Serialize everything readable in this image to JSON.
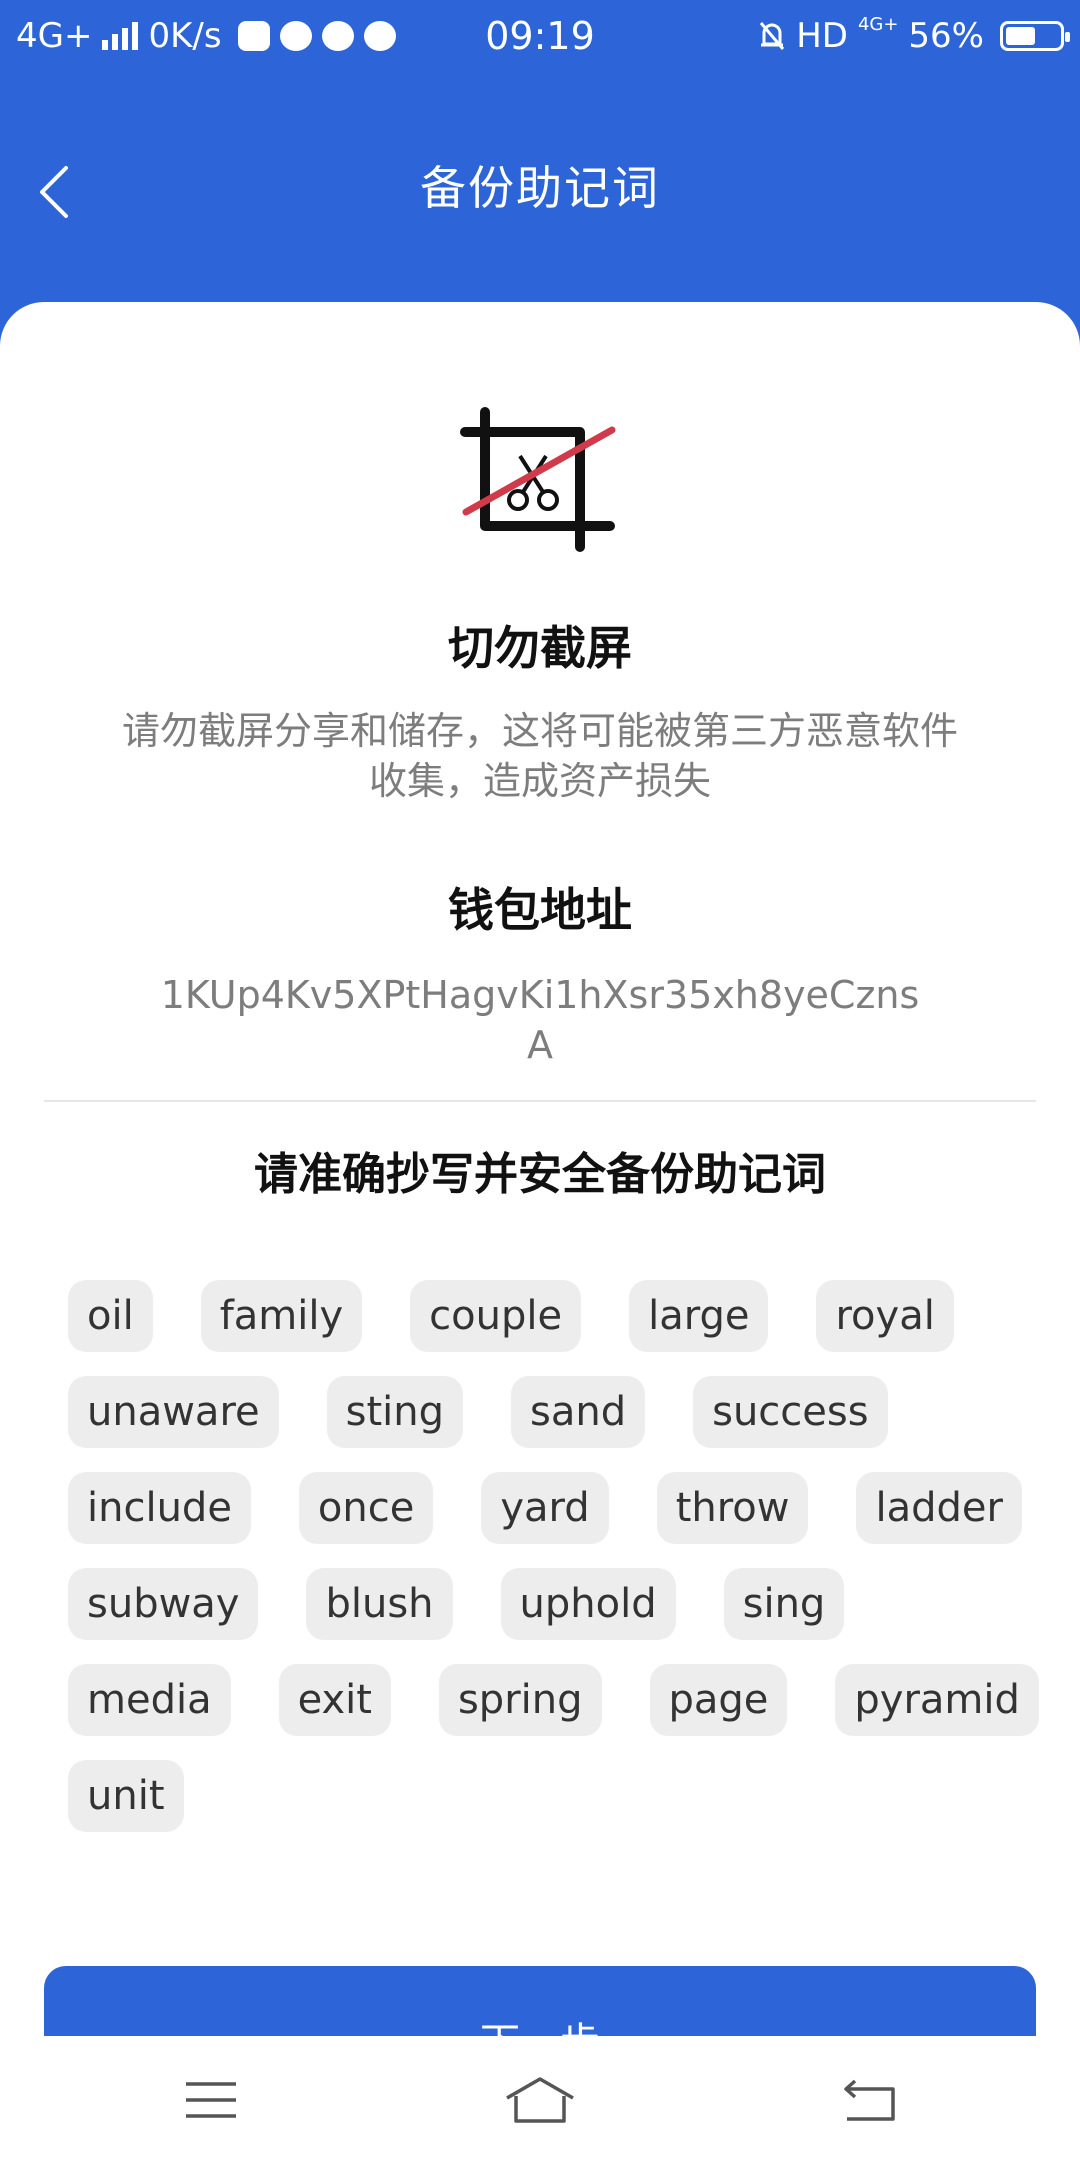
{
  "status_bar": {
    "network": "4G+",
    "speed": "0K/s",
    "time": "09:19",
    "hd": "HD",
    "network_right": "4G+",
    "battery": "56%",
    "battery_level": 0.56
  },
  "header": {
    "title": "备份助记词"
  },
  "warning": {
    "title": "切勿截屏",
    "text": "请勿截屏分享和储存，这将可能被第三方恶意软件收集，造成资产损失"
  },
  "address": {
    "title": "钱包地址",
    "value": "1KUp4Kv5XPtHagvKi1hXsr35xh8yeCznsA"
  },
  "backup": {
    "title": "请准确抄写并安全备份助记词",
    "words": [
      "oil",
      "family",
      "couple",
      "large",
      "royal",
      "unaware",
      "sting",
      "sand",
      "success",
      "include",
      "once",
      "yard",
      "throw",
      "ladder",
      "subway",
      "blush",
      "uphold",
      "sing",
      "media",
      "exit",
      "spring",
      "page",
      "pyramid",
      "unit"
    ]
  },
  "next_button": {
    "label": "下一步"
  },
  "colors": {
    "brand": "#2d65d8",
    "chip_bg": "#ededed",
    "strike": "#d03a4a"
  }
}
